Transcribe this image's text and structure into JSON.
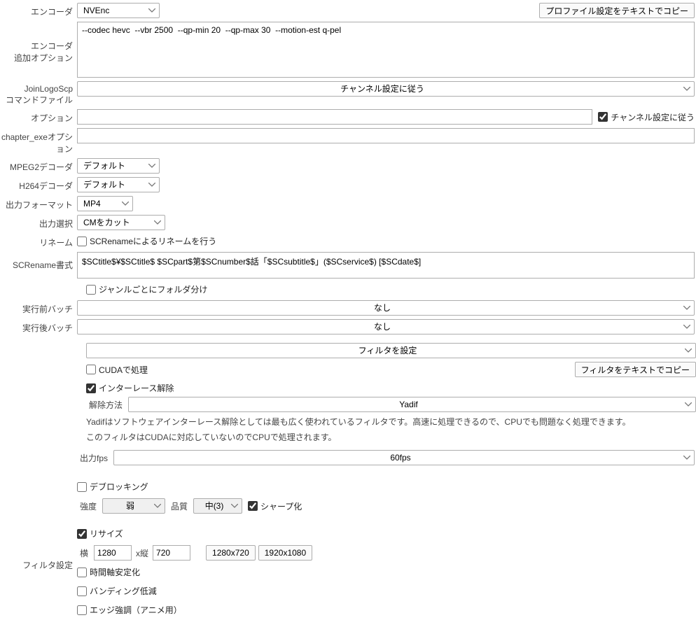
{
  "header": {
    "copy_profile_btn": "プロファイル設定をテキストでコピー"
  },
  "encoder": {
    "label": "エンコーダ",
    "value": "NVEnc"
  },
  "encoder_opts": {
    "label": "エンコーダ\n追加オプション",
    "value": "--codec hevc  --vbr 2500  --qp-min 20  --qp-max 30  --motion-est q-pel"
  },
  "jlscmd": {
    "label": "JoinLogoScp\nコマンドファイル",
    "value": "チャンネル設定に従う"
  },
  "jlsopt": {
    "label": "オプション",
    "value": "",
    "chk_label": "チャンネル設定に従う"
  },
  "chapterexe": {
    "label": "chapter_exeオプション",
    "value": ""
  },
  "mpeg2": {
    "label": "MPEG2デコーダ",
    "value": "デフォルト"
  },
  "h264": {
    "label": "H264デコーダ",
    "value": "デフォルト"
  },
  "outfmt": {
    "label": "出力フォーマット",
    "value": "MP4"
  },
  "outsel": {
    "label": "出力選択",
    "value": "CMをカット"
  },
  "rename": {
    "label": "リネーム",
    "chk_label": "SCRenameによるリネームを行う"
  },
  "scfmt": {
    "label": "SCRename書式",
    "value": "$SCtitle$¥$SCtitle$ $SCpart$第$SCnumber$話「$SCsubtitle$」($SCservice$) [$SCdate$]"
  },
  "genre_folder": {
    "chk_label": "ジャンルごとにフォルダ分け"
  },
  "prebatch": {
    "label": "実行前バッチ",
    "value": "なし"
  },
  "postbatch": {
    "label": "実行後バッチ",
    "value": "なし"
  },
  "filter": {
    "label": "フィルタ設定",
    "set_btn": "フィルタを設定",
    "copy_btn": "フィルタをテキストでコピー",
    "cuda_label": "CUDAで処理",
    "deint_label": "インターレース解除",
    "method_label": "解除方法",
    "method_value": "Yadif",
    "desc1": "Yadifはソフトウェアインターレース解除としては最も広く使われているフィルタです。高速に処理できるので、CPUでも問題なく処理できます。",
    "desc2": "このフィルタはCUDAに対応していないのでCPUで処理されます。",
    "outfps_label": "出力fps",
    "outfps_value": "60fps",
    "deblock_label": "デブロッキング",
    "strength_label": "強度",
    "strength_value": "弱",
    "quality_label": "品質",
    "quality_value": "中(3)",
    "sharpen_label": "シャープ化",
    "resize_label": "リサイズ",
    "width_label": "横",
    "width_value": "1280",
    "height_label": "x縦",
    "height_value": "720",
    "preset1": "1280x720",
    "preset2": "1920x1080",
    "temporal_label": "時間軸安定化",
    "banding_label": "バンディング低減",
    "edge_label": "エッジ強調（アニメ用）"
  }
}
